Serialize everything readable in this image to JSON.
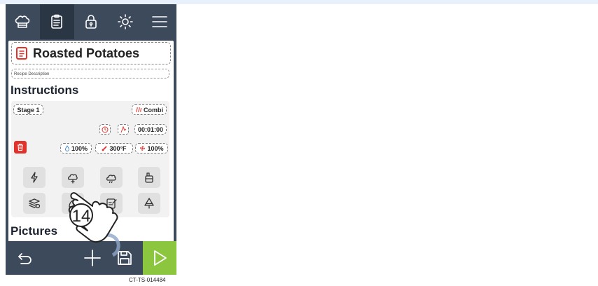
{
  "nav": {
    "icons": [
      "chef-hat-icon",
      "recipe-clipboard-icon",
      "lock-icon",
      "sun-icon",
      "menu-icon"
    ],
    "active_index": 1
  },
  "recipe": {
    "title": "Roasted Potatoes",
    "description_placeholder": "Recipe Description"
  },
  "instructions": {
    "heading": "Instructions",
    "stage_label": "Stage 1",
    "mode_label": "Combi",
    "time": "00:01:00",
    "humidity": "100%",
    "temperature": "300°F",
    "fan": "100%"
  },
  "pictures": {
    "heading": "Pictures"
  },
  "annotation": {
    "step_number": "14"
  },
  "footer": {
    "code": "CT-TS-014484"
  },
  "colors": {
    "device_bg": "#3d4a5c",
    "active_tab": "#2b3645",
    "accent_red": "#e2322c",
    "play_green": "#8cc63f"
  }
}
